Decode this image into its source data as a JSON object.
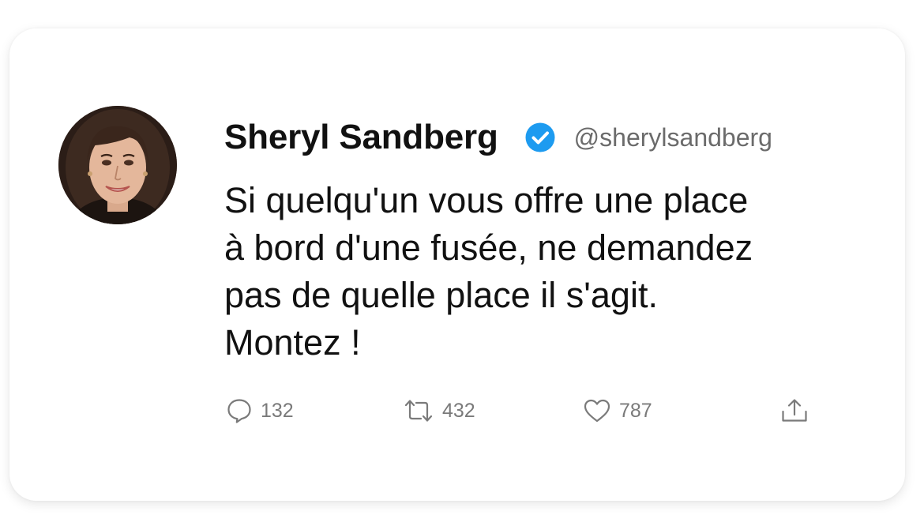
{
  "tweet": {
    "author_name": "Sheryl Sandberg",
    "author_handle": "@sherylsandberg",
    "verified": true,
    "text_lines": [
      "Si quelqu'un vous offre une place",
      "à bord d'une fusée, ne demandez",
      "pas de quelle place il s'agit.",
      "Montez !"
    ],
    "stats": {
      "replies": "132",
      "retweets": "432",
      "likes": "787"
    }
  },
  "icons": {
    "avatar": "profile-photo",
    "verified": "verified-badge-icon",
    "reply": "speech-bubble-icon",
    "retweet": "retweet-arrows-icon",
    "like": "heart-icon",
    "share": "share-upload-icon"
  },
  "colors": {
    "verified_badge": "#1d9bf0",
    "text": "#111111",
    "muted": "#6b6b6b"
  }
}
